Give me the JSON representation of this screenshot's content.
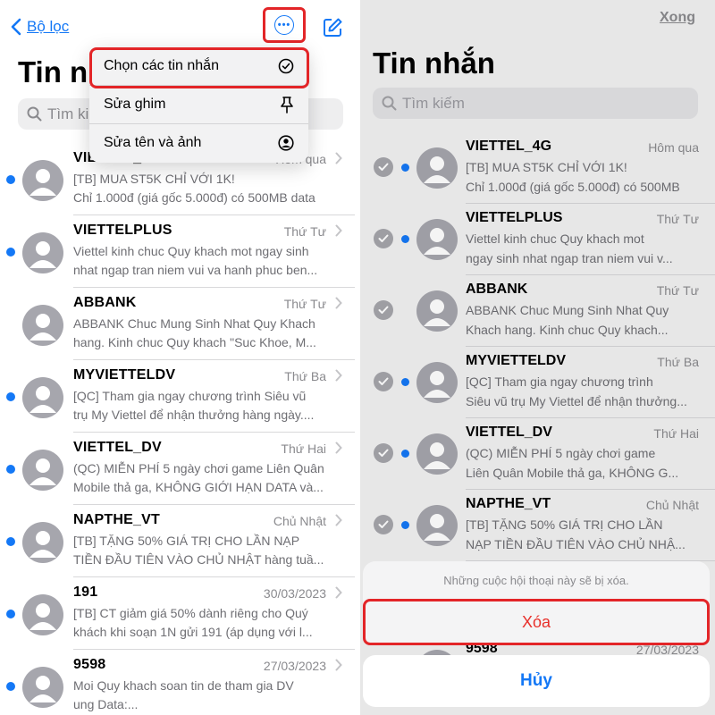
{
  "left": {
    "back_label": "Bộ lọc",
    "title": "Tin nhắn",
    "search_placeholder": "Tìm kiếm",
    "menu": {
      "items": [
        {
          "label": "Chọn các tin nhắn",
          "icon": "checkmark-circle-icon"
        },
        {
          "label": "Sửa ghim",
          "icon": "pin-icon"
        },
        {
          "label": "Sửa tên và ảnh",
          "icon": "person-circle-icon"
        }
      ]
    },
    "rows": [
      {
        "sender": "VIETTEL_4G",
        "time": "Hôm qua",
        "line1": "[TB] MUA ST5K CHỈ VỚI 1K!",
        "line2": "Chỉ 1.000đ (giá gốc 5.000đ) có 500MB data",
        "unread": true
      },
      {
        "sender": "VIETTELPLUS",
        "time": "Thứ Tư",
        "line1": "Viettel kinh chuc Quy khach mot ngay sinh",
        "line2": "nhat ngap tran niem vui va hanh phuc ben...",
        "unread": true
      },
      {
        "sender": "ABBANK",
        "time": "Thứ Tư",
        "line1": "ABBANK Chuc Mung Sinh Nhat Quy Khach",
        "line2": "hang. Kinh chuc Quy khach \"Suc Khoe, M...",
        "unread": false
      },
      {
        "sender": "MYVIETTELDV",
        "time": "Thứ Ba",
        "line1": "[QC] Tham gia ngay chương trình Siêu vũ",
        "line2": "trụ My Viettel để nhận thưởng hàng ngày....",
        "unread": true
      },
      {
        "sender": "VIETTEL_DV",
        "time": "Thứ Hai",
        "line1": "(QC) MIỄN PHÍ 5 ngày chơi game Liên Quân",
        "line2": "Mobile thả ga, KHÔNG GIỚI HẠN DATA và...",
        "unread": true
      },
      {
        "sender": "NAPTHE_VT",
        "time": "Chủ Nhật",
        "line1": "[TB] TẶNG 50% GIÁ TRỊ CHO LẦN NẠP",
        "line2": "TIỀN ĐẦU TIÊN VÀO CHỦ NHẬT hàng tuầ...",
        "unread": true
      },
      {
        "sender": "191",
        "time": "30/03/2023",
        "line1": "[TB] CT giảm giá 50% dành riêng cho Quý",
        "line2": "khách khi soạn 1N gửi 191 (áp dụng với l...",
        "unread": true
      },
      {
        "sender": "9598",
        "time": "27/03/2023",
        "line1": "Moi Quy khach soan tin de tham gia DV",
        "line2": "ung Data:...",
        "unread": true
      }
    ]
  },
  "right": {
    "done_label": "Xong",
    "title": "Tin nhắn",
    "search_placeholder": "Tìm kiếm",
    "rows": [
      {
        "sender": "VIETTEL_4G",
        "time": "Hôm qua",
        "line1": "[TB] MUA ST5K CHỈ VỚI 1K!",
        "line2": "Chỉ 1.000đ (giá gốc 5.000đ) có 500MB",
        "unread": true
      },
      {
        "sender": "VIETTELPLUS",
        "time": "Thứ Tư",
        "line1": "Viettel kinh chuc Quy khach mot",
        "line2": "ngay sinh nhat ngap tran niem vui v...",
        "unread": true
      },
      {
        "sender": "ABBANK",
        "time": "Thứ Tư",
        "line1": "ABBANK Chuc Mung Sinh Nhat Quy",
        "line2": "Khach hang. Kinh chuc Quy khach...",
        "unread": false
      },
      {
        "sender": "MYVIETTELDV",
        "time": "Thứ Ba",
        "line1": "[QC] Tham gia ngay chương trình",
        "line2": "Siêu vũ trụ My Viettel để nhận thưởng...",
        "unread": true
      },
      {
        "sender": "VIETTEL_DV",
        "time": "Thứ Hai",
        "line1": "(QC) MIỄN PHÍ 5 ngày chơi game",
        "line2": "Liên Quân Mobile thả ga, KHÔNG G...",
        "unread": true
      },
      {
        "sender": "NAPTHE_VT",
        "time": "Chủ Nhật",
        "line1": "[TB] TẶNG 50% GIÁ TRỊ CHO LẦN",
        "line2": "NẠP TIỀN ĐẦU TIÊN VÀO CHỦ NHẬ...",
        "unread": true
      },
      {
        "sender": "9598",
        "time": "27/03/2023",
        "line1": "",
        "line2": "",
        "unread": true
      }
    ],
    "sheet_message": "Những cuộc hội thoại này sẽ bị xóa.",
    "delete_label": "Xóa",
    "cancel_label": "Hủy"
  },
  "colors": {
    "accent": "#1478f6",
    "highlight": "#e32528",
    "destructive": "#e8302b",
    "avatar": "#a6a6ad",
    "secondary_text": "#8a8a8e"
  }
}
